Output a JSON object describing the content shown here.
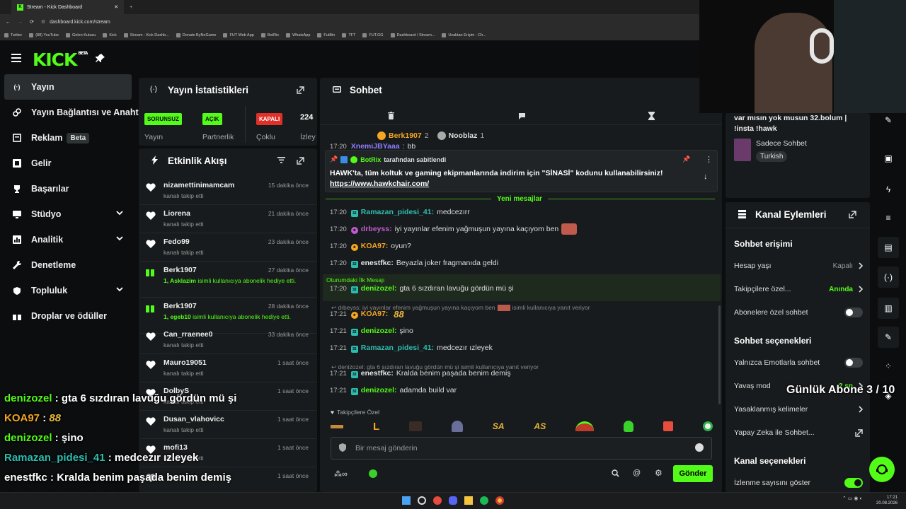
{
  "browser": {
    "tabs": [
      {
        "label": "Stream - Kick Dashboard",
        "active": true
      }
    ],
    "url": "dashboard.kick.com/stream",
    "bookmarks": [
      "Twitter",
      "(88) YouTube",
      "Gelen Kutusu",
      "Kick",
      "Stream - Kick Dashb...",
      "Donate ByNoGame",
      "FUT Web App",
      "BotRix",
      "WhatsApp",
      "FutBin",
      "TFT",
      "FUT.GG",
      "Dashboard / Stream...",
      "Uzaktan Erişim - Ch..."
    ]
  },
  "brand": {
    "logo": "KICK",
    "beta": "BETA",
    "accent": "#53fc18"
  },
  "sidebar": {
    "items": [
      {
        "label": "Yayın",
        "icon": "broadcast-icon",
        "active": true
      },
      {
        "label": "Yayın Bağlantısı ve Anahtar",
        "icon": "link-icon"
      },
      {
        "label": "Reklam",
        "icon": "ad-icon",
        "badge": "Beta"
      },
      {
        "label": "Gelir",
        "icon": "revenue-icon"
      },
      {
        "label": "Başarılar",
        "icon": "trophy-icon"
      },
      {
        "label": "Stüdyo",
        "icon": "studio-icon",
        "expandable": true
      },
      {
        "label": "Analitik",
        "icon": "analytics-icon",
        "expandable": true
      },
      {
        "label": "Denetleme",
        "icon": "wrench-icon"
      },
      {
        "label": "Topluluk",
        "icon": "community-icon",
        "expandable": true
      },
      {
        "label": "Droplar ve ödüller",
        "icon": "gift-icon"
      }
    ]
  },
  "stats": {
    "title": "Yayın İstatistikleri",
    "badges": [
      {
        "text": "SORUNSUZ",
        "color": "#53fc18",
        "label": "Yayın"
      },
      {
        "text": "AÇIK",
        "color": "#53fc18",
        "label": "Partnerlik"
      },
      {
        "text": "KAPALI",
        "color": "#e0302a",
        "label": "Çoklu"
      },
      {
        "text": "224",
        "label": "İzleyi"
      }
    ]
  },
  "activity": {
    "title": "Etkinlik Akışı",
    "events": [
      {
        "name": "nizamettinimamcam",
        "desc": "kanalı takip etti",
        "time": "15 dakika önce",
        "type": "follow"
      },
      {
        "name": "Liorena",
        "desc": "kanalı takip etti",
        "time": "21 dakika önce",
        "type": "follow"
      },
      {
        "name": "Fedo99",
        "desc": "kanalı takip etti",
        "time": "23 dakika önce",
        "type": "follow"
      },
      {
        "name": "Berk1907",
        "desc_pre": "1, ",
        "desc_user": "Asklazim",
        "desc": " isimli kullanıcıya abonelik hediye etti.",
        "time": "27 dakika önce",
        "type": "gift"
      },
      {
        "name": "Berk1907",
        "desc_pre": "1, ",
        "desc_user": "egeb10",
        "desc": " isimli kullanıcıya abonelik hediye etti.",
        "time": "28 dakika önce",
        "type": "gift"
      },
      {
        "name": "Can_rraenee0",
        "desc": "kanalı takip etti",
        "time": "33 dakika önce",
        "type": "follow"
      },
      {
        "name": "Mauro19051",
        "desc": "kanalı takip etti",
        "time": "1 saat önce",
        "type": "follow"
      },
      {
        "name": "DolbyS",
        "desc": "kanalı takip etti",
        "time": "1 saat önce",
        "type": "follow"
      },
      {
        "name": "Dusan_vlahovicc",
        "desc": "kanalı takip etti",
        "time": "1 saat önce",
        "type": "follow"
      },
      {
        "name": "mofi13",
        "desc": "kanalı takip etti",
        "time": "1 saat önce",
        "type": "follow"
      },
      {
        "name": "",
        "desc": "",
        "time": "1 saat önce",
        "type": "follow"
      }
    ]
  },
  "chat": {
    "title": "Sohbet",
    "top_gifters": [
      {
        "name": "Berk1907",
        "count": "2"
      },
      {
        "name": "Nooblaz",
        "count": "1"
      }
    ],
    "partial_line": {
      "time": "17:20",
      "user": "XnemiJBYaaa",
      "text": "bb"
    },
    "pinned": {
      "by_user": "BotRix",
      "by_text": "tarafından sabitlendi",
      "text": "HAWK'ta, tüm koltuk ve gaming ekipmanlarında indirim için \"SİNASİ\" kodunu kullanabilirsiniz!",
      "link": "https://www.hawkchair.com/"
    },
    "new_messages": "Yeni mesajlar",
    "first_message_label": "Oturumdaki İlk Mesajı",
    "messages": [
      {
        "time": "17:20",
        "user": "Ramazan_pidesi_41",
        "color": "#2dbdb0",
        "text": "medcezırr"
      },
      {
        "time": "17:20",
        "user": "drbeyss",
        "color": "#c15ccf",
        "text": "iyi yayınlar efenim yağmuşun yayına kaçıyom ben"
      },
      {
        "time": "17:20",
        "user": "KOA97",
        "color": "#f5a623",
        "text": "oyun?"
      },
      {
        "time": "17:20",
        "user": "enestfkc",
        "color": "#e6e6e6",
        "text": "Beyazla joker fragmanıda geldi"
      },
      {
        "time": "17:20",
        "user": "denizozel",
        "color": "#53fc18",
        "text": "gta 6 sızdıran lavuğu gördün mü şi"
      },
      {
        "reply": "drbeyss: iyi yayınlar efenim yağmuşun yayına kaçıyom ben",
        "reply_suffix": "isimli kullanıcıya yanıt veriyor",
        "time": "17:21",
        "user": "KOA97",
        "color": "#f5a623",
        "text": ""
      },
      {
        "time": "17:21",
        "user": "denizozel",
        "color": "#53fc18",
        "text": "şino"
      },
      {
        "time": "17:21",
        "user": "Ramazan_pidesi_41",
        "color": "#2dbdb0",
        "text": "medcezır ızleyek"
      },
      {
        "reply": "denizozel: gta 6 sızdıran lavuğu gördün mü şi isimli kullanıcıya yanıt veriyor",
        "time": "17:21",
        "user": "enestfkc",
        "color": "#e6e6e6",
        "text": "Kralda benim paşada benim demiş"
      },
      {
        "time": "17:21",
        "user": "denizozel",
        "color": "#53fc18",
        "text": "adamda build var"
      }
    ],
    "followers_only": "Takipçilere Özel",
    "input_placeholder": "Bir mesaj gönderin",
    "send": "Gönder"
  },
  "stream_info": {
    "title_line": "var mısın yok musun 32.bolum |",
    "title_line2": "!insta !hawk",
    "chat_mode": "Sadece Sohbet",
    "language": "Turkish"
  },
  "channel_actions": {
    "title": "Kanal Eylemleri",
    "sections": [
      {
        "title": "Sohbet erişimi",
        "rows": [
          {
            "label": "Hesap yaşı",
            "value": "Kapalı",
            "kind": "chevron"
          },
          {
            "label": "Takipçilere özel...",
            "value": "Anında",
            "kind": "chevron",
            "value_color": "#53fc18"
          },
          {
            "label": "Abonelere özel sohbet",
            "kind": "toggle",
            "on": false
          }
        ]
      },
      {
        "title": "Sohbet seçenekleri",
        "rows": [
          {
            "label": "Yalnızca Emotlarla sohbet",
            "kind": "toggle",
            "on": false
          },
          {
            "label": "Yavaş mod",
            "value": "2 sn",
            "kind": "chevron",
            "value_color": "#53fc18"
          },
          {
            "label": "Yasaklanmış kelimeler",
            "kind": "chevron"
          },
          {
            "label": "Yapay Zeka ile Sohbet...",
            "kind": "external"
          }
        ]
      },
      {
        "title": "Kanal seçenekleri",
        "rows": [
          {
            "label": "İzlenme sayısını göster",
            "kind": "toggle",
            "on": true
          }
        ]
      }
    ]
  },
  "overlay": {
    "goal": "Günlük Abone 3 / 10",
    "chat": [
      {
        "user": "denizozel",
        "color": "#53fc18",
        "text": "gta 6 sızdıran lavuğu gördün mü şi"
      },
      {
        "user": "KOA97",
        "color": "#f5a623",
        "text": ""
      },
      {
        "user": "denizozel",
        "color": "#53fc18",
        "text": "şino"
      },
      {
        "user": "Ramazan_pidesi_41",
        "color": "#2dbdb0",
        "text": "medcezır ızleyek"
      },
      {
        "user": "enestfkc",
        "color": "#ffffff",
        "text": "Kralda benim paşada benim demiş"
      },
      {
        "user": "denizozel",
        "color": "#53fc18",
        "text": "adamda build var"
      }
    ]
  },
  "taskbar": {
    "time": "17:21",
    "date": "20.08.2026"
  }
}
